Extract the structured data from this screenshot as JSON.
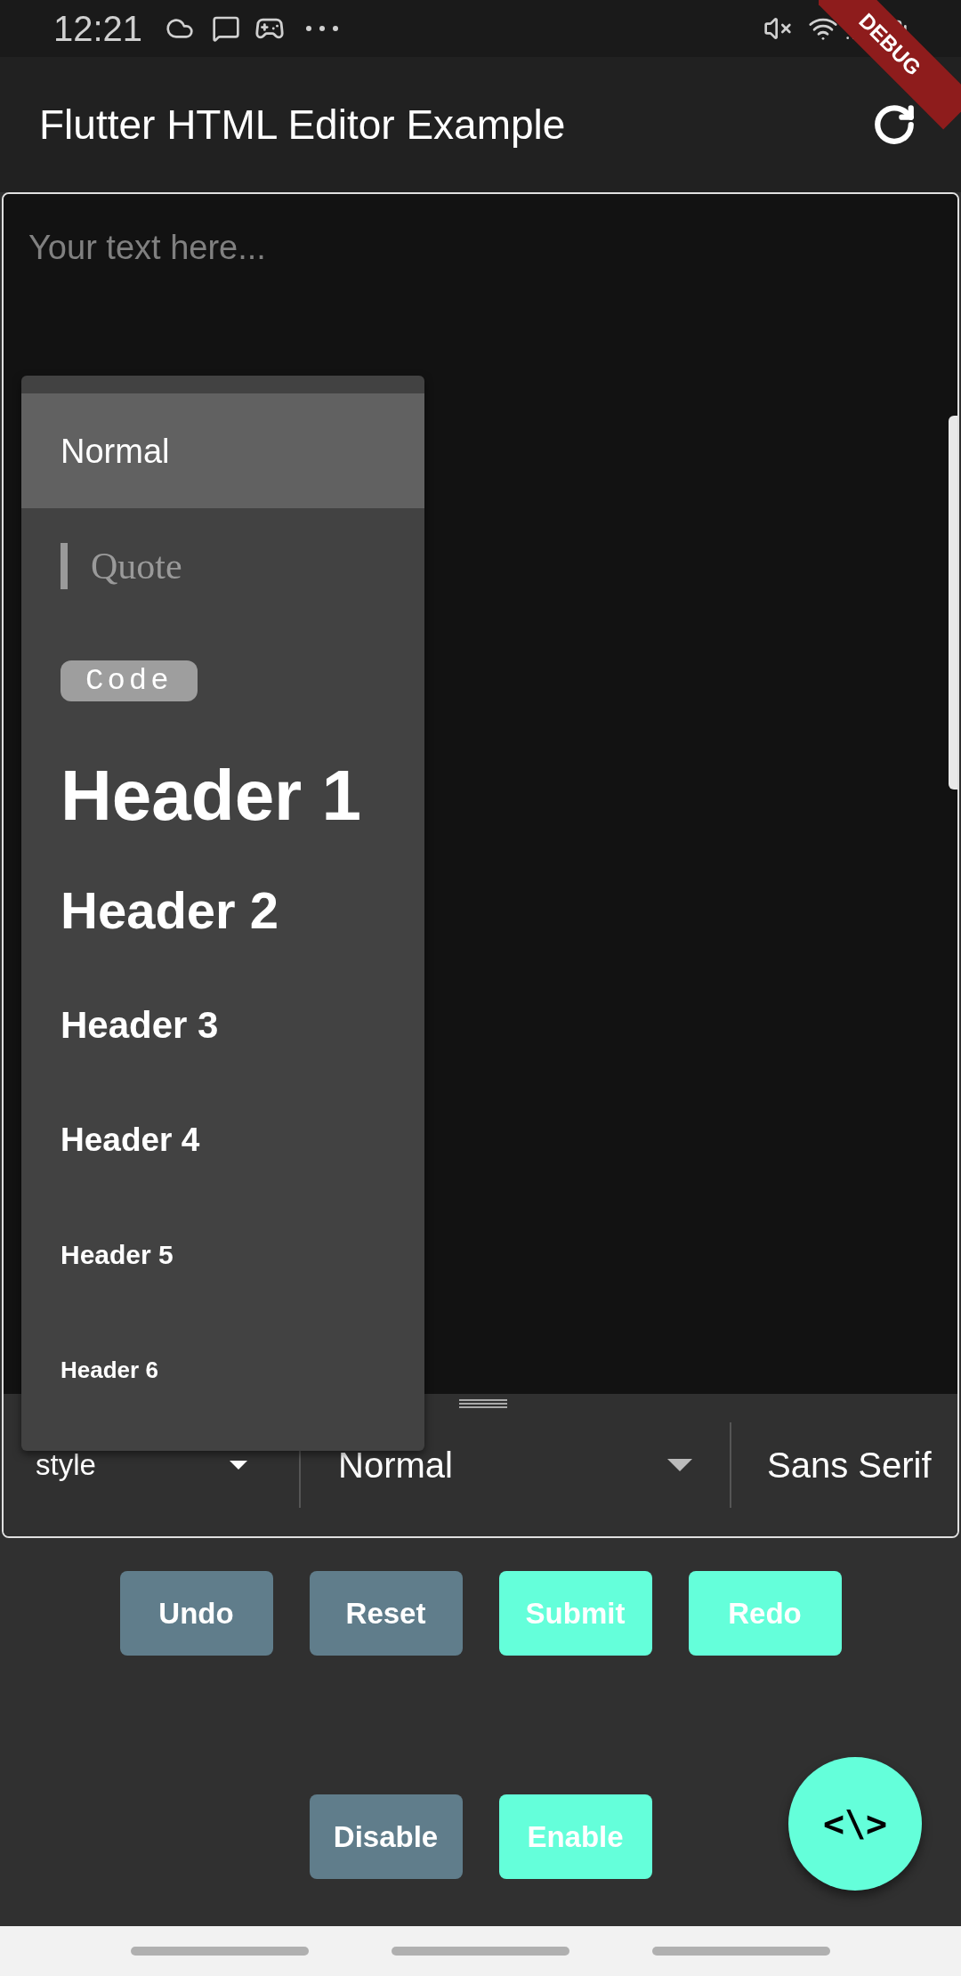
{
  "status_bar": {
    "time": "12:21"
  },
  "debug_banner": "DEBUG",
  "app_bar": {
    "title": "Flutter HTML Editor Example"
  },
  "editor": {
    "placeholder": "Your text here..."
  },
  "style_menu": {
    "items": [
      {
        "kind": "normal",
        "label": "Normal",
        "selected": true
      },
      {
        "kind": "quote",
        "label": "Quote",
        "selected": false
      },
      {
        "kind": "code",
        "label": "Code",
        "selected": false
      },
      {
        "kind": "h1",
        "label": "Header 1",
        "selected": false
      },
      {
        "kind": "h2",
        "label": "Header 2",
        "selected": false
      },
      {
        "kind": "h3",
        "label": "Header 3",
        "selected": false
      },
      {
        "kind": "h4",
        "label": "Header 4",
        "selected": false
      },
      {
        "kind": "h5",
        "label": "Header 5",
        "selected": false
      },
      {
        "kind": "h6",
        "label": "Header 6",
        "selected": false
      }
    ]
  },
  "toolbar": {
    "dropdowns": [
      "style",
      "Normal",
      "Sans Serif"
    ]
  },
  "button_rows": [
    [
      {
        "label": "Undo",
        "color": "#607d8b"
      },
      {
        "label": "Reset",
        "color": "#607d8b"
      },
      {
        "label": "Submit",
        "color": "#64ffda"
      },
      {
        "label": "Redo",
        "color": "#64ffda"
      }
    ],
    [
      {
        "label": "Disable",
        "color": "#607d8b"
      },
      {
        "label": "Enable",
        "color": "#64ffda"
      }
    ]
  ],
  "fab": {
    "label": "<\\>"
  }
}
